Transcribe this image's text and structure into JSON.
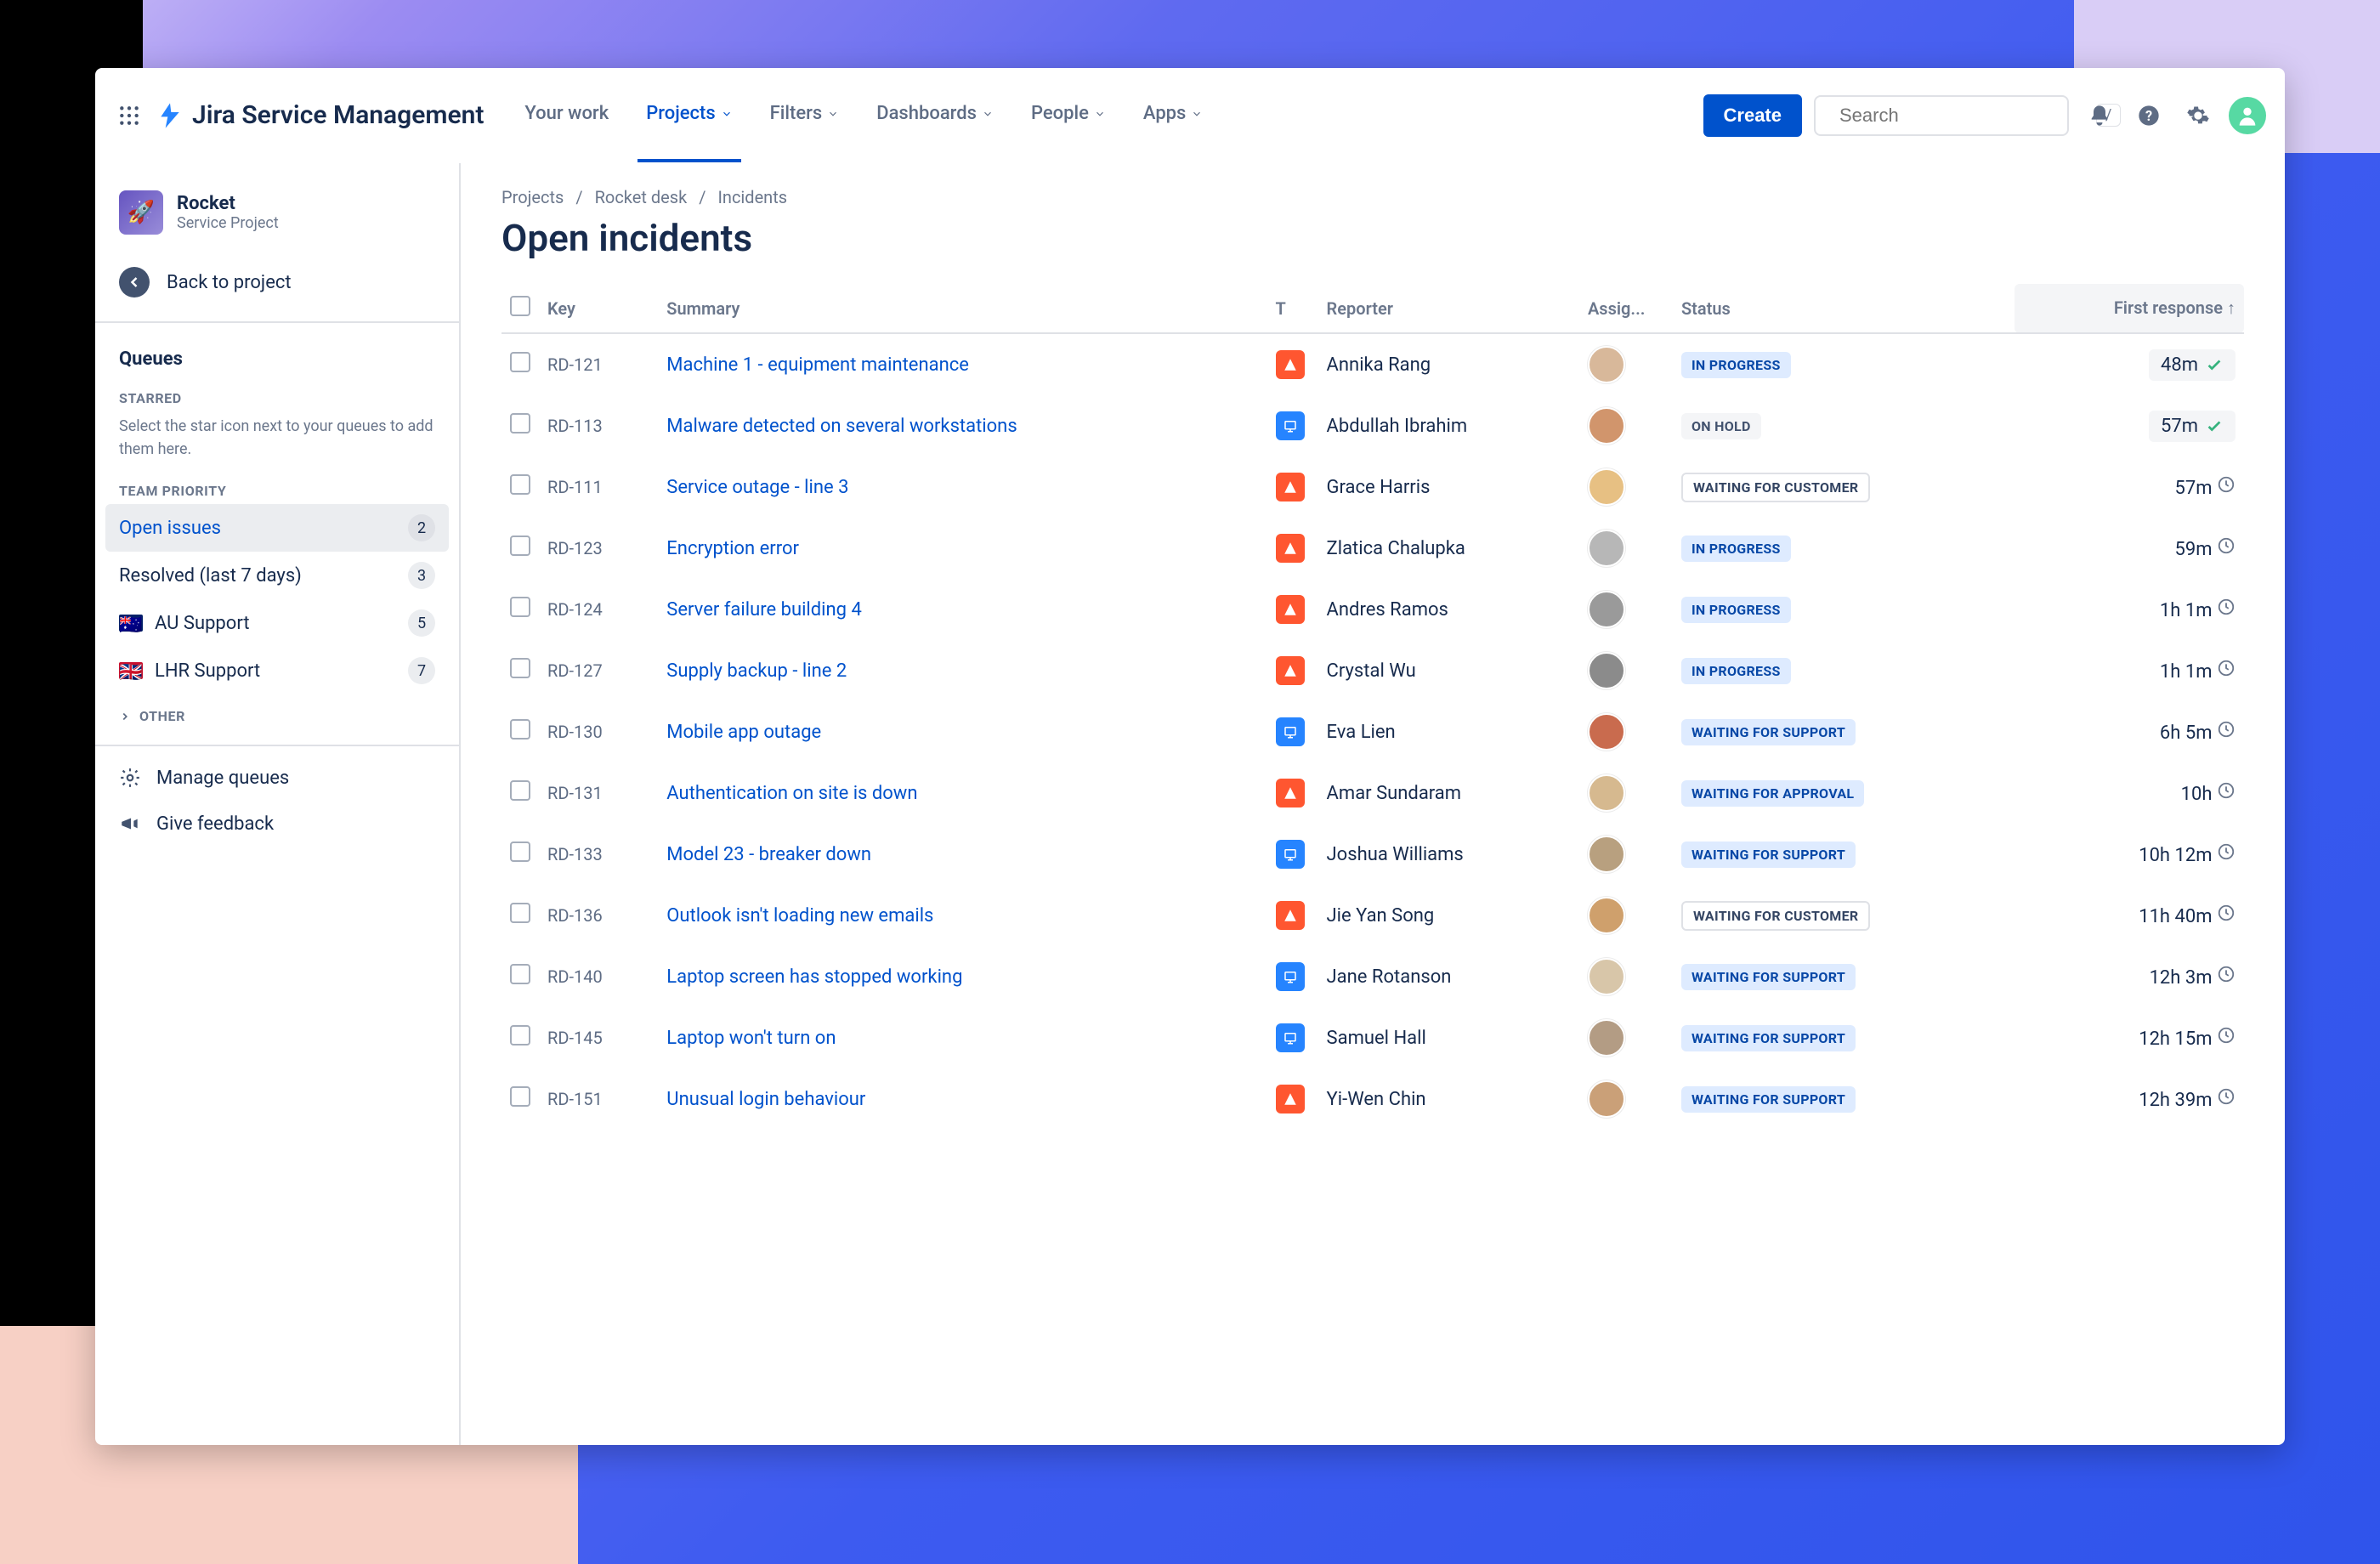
{
  "header": {
    "product_name": "Jira Service Management",
    "nav": [
      {
        "label": "Your work",
        "dropdown": false
      },
      {
        "label": "Projects",
        "dropdown": true,
        "active": true
      },
      {
        "label": "Filters",
        "dropdown": true
      },
      {
        "label": "Dashboards",
        "dropdown": true
      },
      {
        "label": "People",
        "dropdown": true
      },
      {
        "label": "Apps",
        "dropdown": true
      }
    ],
    "create_label": "Create",
    "search_placeholder": "Search",
    "search_kbd": "/"
  },
  "sidebar": {
    "project": {
      "name": "Rocket",
      "subtitle": "Service Project"
    },
    "back_label": "Back to project",
    "queues_label": "Queues",
    "starred_label": "STARRED",
    "hint": "Select the star icon next to your queues to add them here.",
    "team_label": "TEAM PRIORITY",
    "queues": [
      {
        "label": "Open issues",
        "count": "2",
        "active": true,
        "flag": null
      },
      {
        "label": "Resolved (last 7 days)",
        "count": "3",
        "flag": null
      },
      {
        "label": "AU Support",
        "count": "5",
        "flag": "au"
      },
      {
        "label": "LHR Support",
        "count": "7",
        "flag": "uk"
      }
    ],
    "other_label": "OTHER",
    "manage_label": "Manage queues",
    "feedback_label": "Give feedback"
  },
  "main": {
    "crumbs": [
      "Projects",
      "Rocket desk",
      "Incidents"
    ],
    "title": "Open incidents",
    "columns": {
      "key": "Key",
      "summary": "Summary",
      "type": "T",
      "reporter": "Reporter",
      "assignee": "Assig...",
      "status": "Status",
      "first_response": "First response"
    },
    "status_styles": {
      "IN PROGRESS": "blue",
      "ON HOLD": "grey",
      "WAITING FOR CUSTOMER": "white",
      "WAITING FOR SUPPORT": "blue",
      "WAITING FOR APPROVAL": "blue"
    },
    "rows": [
      {
        "key": "RD-121",
        "summary": "Machine 1 - equipment maintenance",
        "type": "orange",
        "reporter": "Annika Rang",
        "status": "IN PROGRESS",
        "resp": "48m",
        "resp_icon": "check",
        "resp_pill": true,
        "ava": "#d8b89a"
      },
      {
        "key": "RD-113",
        "summary": "Malware detected on several workstations",
        "type": "cyan",
        "reporter": "Abdullah Ibrahim",
        "status": "ON HOLD",
        "resp": "57m",
        "resp_icon": "check",
        "resp_pill": true,
        "ava": "#d1956c"
      },
      {
        "key": "RD-111",
        "summary": "Service outage - line 3",
        "type": "orange",
        "reporter": "Grace Harris",
        "status": "WAITING FOR CUSTOMER",
        "resp": "57m",
        "resp_icon": "clock",
        "ava": "#e7c083"
      },
      {
        "key": "RD-123",
        "summary": "Encryption error",
        "type": "orange",
        "reporter": "Zlatica Chalupka",
        "status": "IN PROGRESS",
        "resp": "59m",
        "resp_icon": "clock",
        "ava": "#b7b7b7"
      },
      {
        "key": "RD-124",
        "summary": "Server failure building 4",
        "type": "orange",
        "reporter": "Andres Ramos",
        "status": "IN PROGRESS",
        "resp": "1h 1m",
        "resp_icon": "clock",
        "ava": "#9a9a9a"
      },
      {
        "key": "RD-127",
        "summary": "Supply backup - line 2",
        "type": "orange",
        "reporter": "Crystal Wu",
        "status": "IN PROGRESS",
        "resp": "1h 1m",
        "resp_icon": "clock",
        "ava": "#8b8b8b"
      },
      {
        "key": "RD-130",
        "summary": "Mobile app outage",
        "type": "cyan",
        "reporter": "Eva Lien",
        "status": "WAITING FOR SUPPORT",
        "resp": "6h 5m",
        "resp_icon": "clock",
        "ava": "#c96b4e"
      },
      {
        "key": "RD-131",
        "summary": "Authentication on site is down",
        "type": "orange",
        "reporter": "Amar Sundaram",
        "status": "WAITING FOR APPROVAL",
        "resp": "10h",
        "resp_icon": "clock",
        "ava": "#d6b98f"
      },
      {
        "key": "RD-133",
        "summary": "Model 23 - breaker down",
        "type": "cyan",
        "reporter": "Joshua Williams",
        "status": "WAITING FOR SUPPORT",
        "resp": "10h 12m",
        "resp_icon": "clock",
        "ava": "#b8a07f"
      },
      {
        "key": "RD-136",
        "summary": "Outlook isn't loading new emails",
        "type": "orange",
        "reporter": "Jie Yan Song",
        "status": "WAITING FOR CUSTOMER",
        "resp": "11h 40m",
        "resp_icon": "clock",
        "ava": "#cfa06c"
      },
      {
        "key": "RD-140",
        "summary": "Laptop screen has stopped working",
        "type": "cyan",
        "reporter": "Jane Rotanson",
        "status": "WAITING FOR SUPPORT",
        "resp": "12h 3m",
        "resp_icon": "clock",
        "ava": "#d8c6a9"
      },
      {
        "key": "RD-145",
        "summary": "Laptop won't turn on",
        "type": "cyan",
        "reporter": "Samuel Hall",
        "status": "WAITING FOR SUPPORT",
        "resp": "12h 15m",
        "resp_icon": "clock",
        "ava": "#b39c84"
      },
      {
        "key": "RD-151",
        "summary": "Unusual login behaviour",
        "type": "orange",
        "reporter": "Yi-Wen Chin",
        "status": "WAITING FOR SUPPORT",
        "resp": "12h 39m",
        "resp_icon": "clock",
        "ava": "#caa078"
      }
    ]
  }
}
